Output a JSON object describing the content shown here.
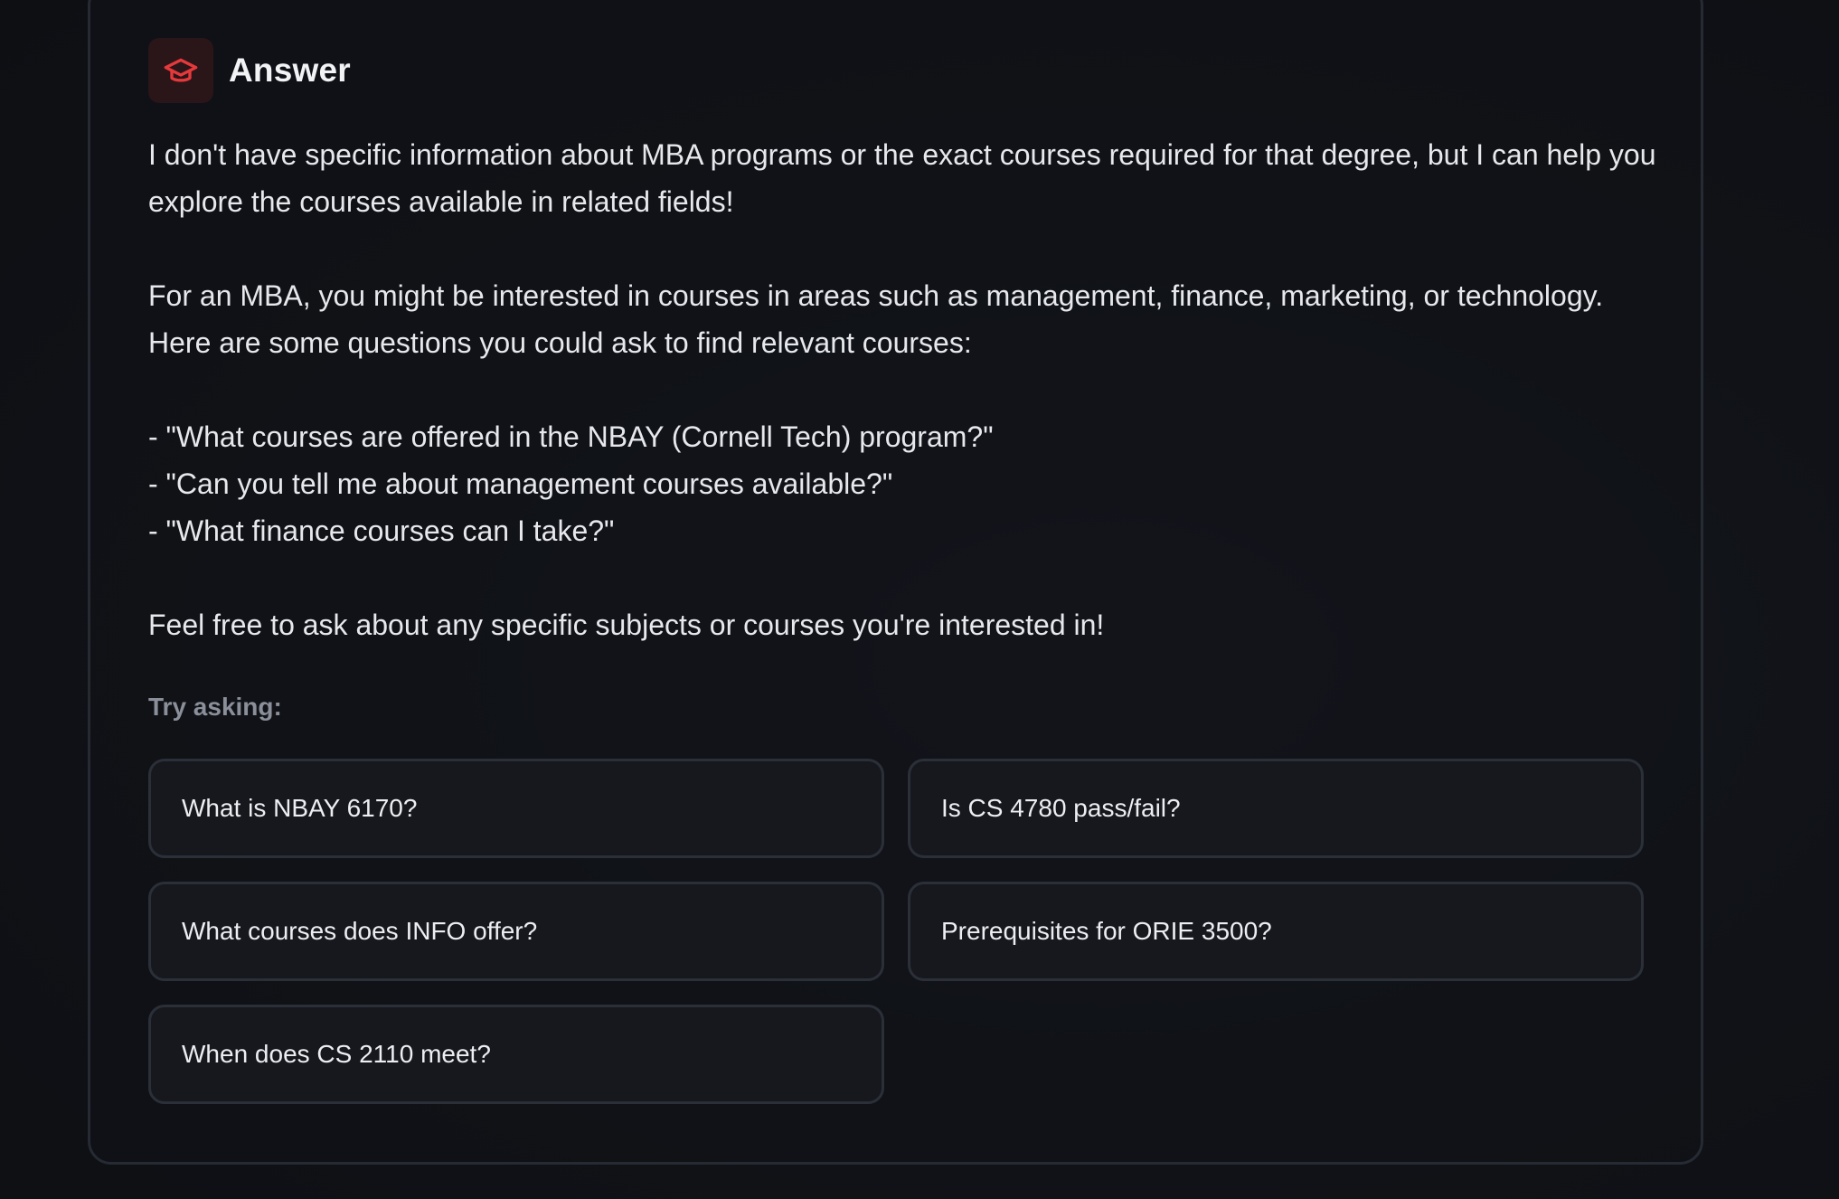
{
  "answer": {
    "title": "Answer",
    "icon": "graduation-cap-icon",
    "accent_color": "#e5393b",
    "paragraphs": [
      "I don't have specific information about MBA programs or the exact courses required for that degree, but I can help you explore the courses available in related fields!",
      "For an MBA, you might be interested in courses in areas such as management, finance, marketing, or technology. Here are some questions you could ask to find relevant courses:"
    ],
    "bullets": [
      "- \"What courses are offered in the NBAY (Cornell Tech) program?\"",
      "- \"Can you tell me about management courses available?\"",
      "- \"What finance courses can I take?\""
    ],
    "closing": "Feel free to ask about any specific subjects or courses you're interested in!"
  },
  "suggestions": {
    "label": "Try asking:",
    "items": [
      "What is NBAY 6170?",
      "Is CS 4780 pass/fail?",
      "What courses does INFO offer?",
      "Prerequisites for ORIE 3500?",
      "When does CS 2110 meet?"
    ]
  }
}
